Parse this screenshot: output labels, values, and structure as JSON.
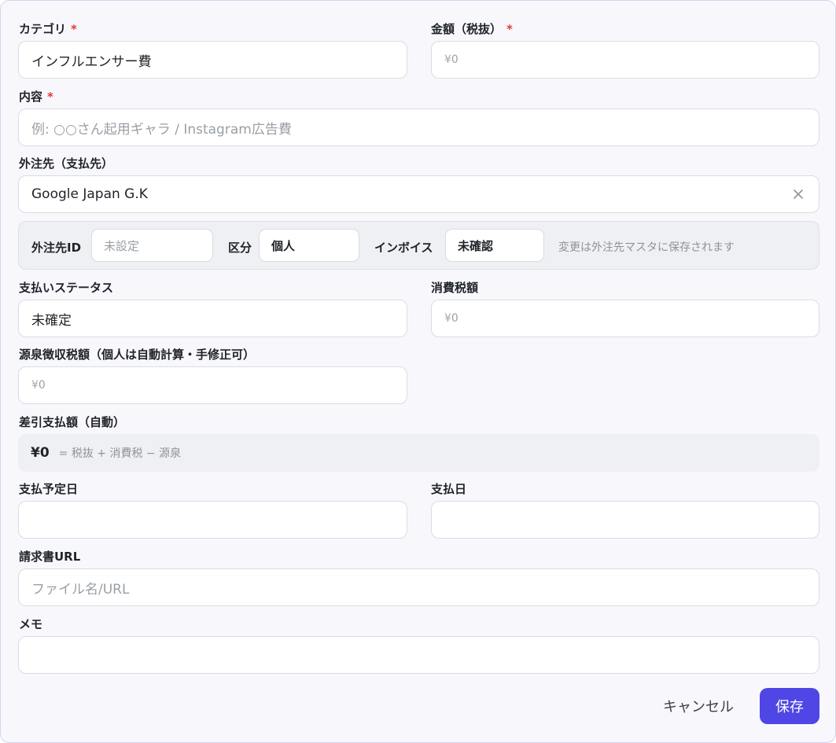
{
  "form": {
    "category": {
      "label": "カテゴリ",
      "required_mark": "*",
      "value": "インフルエンサー費"
    },
    "amount": {
      "label": "金額（税抜）",
      "required_mark": "*",
      "placeholder": "0",
      "currency_symbol": "¥"
    },
    "content": {
      "label": "内容",
      "required_mark": "*",
      "placeholder": "例: ○○さん起用ギャラ / Instagram広告費"
    },
    "vendor": {
      "label": "外注先（支払先）",
      "value": "Google Japan G.K",
      "clear_icon": "close-icon"
    },
    "vendor_details": {
      "vendor_id_label": "外注先ID",
      "vendor_id_placeholder": "未設定",
      "class_label": "区分",
      "class_value": "個人",
      "invoice_label": "インボイス",
      "invoice_value": "未確認",
      "note": "変更は外注先マスタに保存されます"
    },
    "payment_status": {
      "label": "支払いステータス",
      "value": "未確定"
    },
    "consumption_tax": {
      "label": "消費税額",
      "placeholder": "0",
      "currency_symbol": "¥"
    },
    "withholding": {
      "label": "源泉徴収税額（個人は自動計算・手修正可）",
      "placeholder": "0",
      "currency_symbol": "¥"
    },
    "net_payment": {
      "label": "差引支払額（自動）",
      "amount": "¥0",
      "formula": "= 税抜 + 消費税 − 源泉"
    },
    "scheduled_date": {
      "label": "支払予定日",
      "value": ""
    },
    "payment_date": {
      "label": "支払日",
      "value": ""
    },
    "invoice_url": {
      "label": "請求書URL",
      "placeholder": "ファイル名/URL"
    },
    "memo": {
      "label": "メモ",
      "value": ""
    }
  },
  "actions": {
    "cancel_label": "キャンセル",
    "save_label": "保存"
  },
  "colors": {
    "accent": "#4f46e5",
    "required": "#e23a3a",
    "border": "#d4d4f0",
    "background": "#f8f8fc"
  }
}
